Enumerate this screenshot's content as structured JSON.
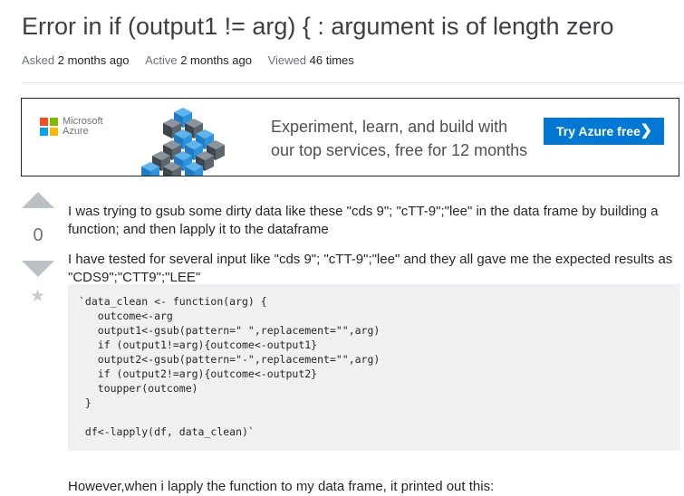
{
  "question": {
    "title": "Error in if (output1 != arg) { : argument is of length zero",
    "meta": {
      "asked_label": "Asked",
      "asked_value": "2 months ago",
      "active_label": "Active",
      "active_value": "2 months ago",
      "viewed_label": "Viewed",
      "viewed_value": "46 times"
    }
  },
  "ad": {
    "brand_line1": "Microsoft",
    "brand_line2": "Azure",
    "headline_line1": "Experiment, learn, and build with",
    "headline_line2": "our top services, free for 12 months",
    "button_label": "Try Azure free",
    "button_icon": "chevron-right-icon",
    "brand_colors": [
      "#f25022",
      "#7fba00",
      "#00a4ef",
      "#ffb900"
    ],
    "button_color": "#0078d4"
  },
  "votes": {
    "count": "0",
    "up_icon": "arrow-up-icon",
    "down_icon": "arrow-down-icon",
    "favorite_icon": "star-icon"
  },
  "body": {
    "paragraph1": "I was trying to gsub some dirty data like these \"cds 9\"; \"cTT-9\";\"lee\" in the data frame by building a function; and then lapply it to the dataframe",
    "paragraph2": "I have tested for several input like \"cds 9\"; \"cTT-9\";\"lee\" and they all gave me the expected results as \"CDS9\";\"CTT9\";\"LEE\"",
    "code_lines": [
      "`data_clean <- function(arg) {",
      "   outcome<-arg",
      "   output1<-gsub(pattern=\" \",replacement=\"\",arg)",
      "   if (output1!=arg){outcome<-output1}",
      "   output2<-gsub(pattern=\"-\",replacement=\"\",arg)",
      "   if (output2!=arg){outcome<-output2}",
      "   toupper(outcome)",
      " }",
      "",
      " df<-lapply(df, data_clean)`"
    ],
    "paragraph3": "However,when i lapply the function to my data frame, it printed out this:"
  }
}
